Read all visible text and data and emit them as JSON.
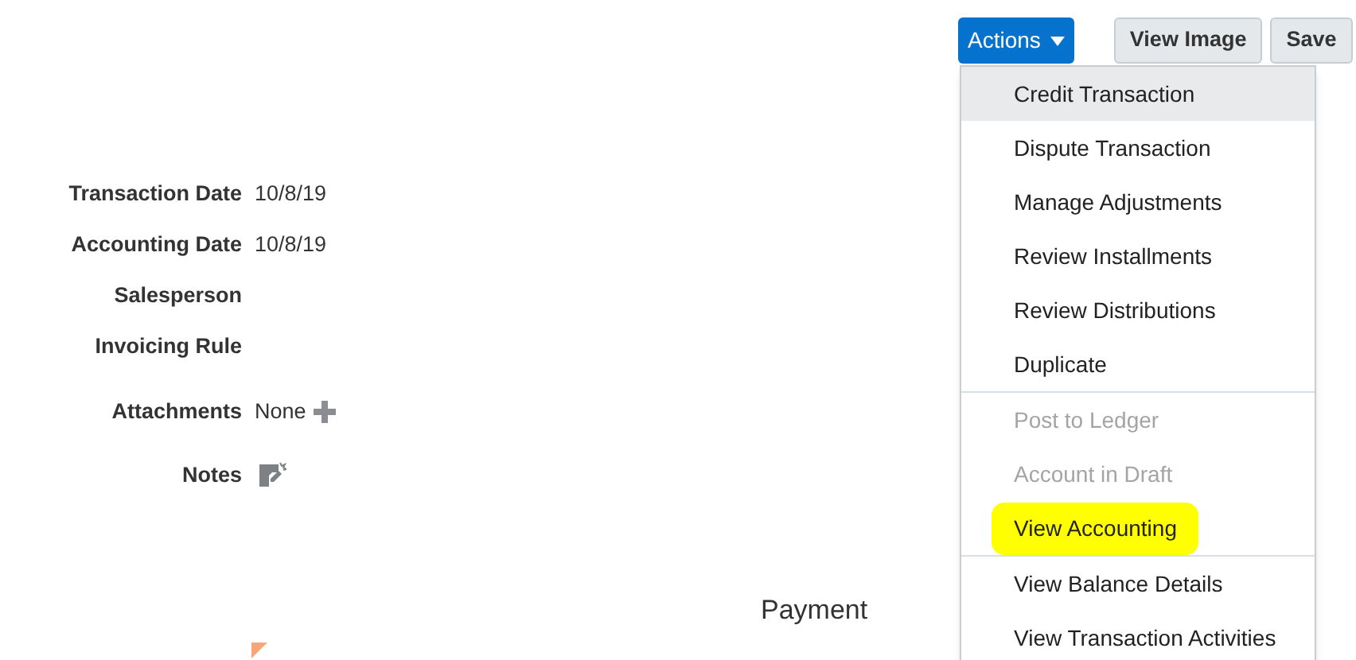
{
  "toolbar": {
    "actions_button": "Actions",
    "buttons": [
      "View Image",
      "Save"
    ]
  },
  "actions_menu": {
    "groups": [
      {
        "items": [
          {
            "label": "Credit Transaction",
            "selected": true,
            "disabled": false,
            "marker_highlight": false
          },
          {
            "label": "Dispute Transaction",
            "selected": false,
            "disabled": false,
            "marker_highlight": false
          },
          {
            "label": "Manage Adjustments",
            "selected": false,
            "disabled": false,
            "marker_highlight": false
          },
          {
            "label": "Review Installments",
            "selected": false,
            "disabled": false,
            "marker_highlight": false
          },
          {
            "label": "Review Distributions",
            "selected": false,
            "disabled": false,
            "marker_highlight": false
          },
          {
            "label": "Duplicate",
            "selected": false,
            "disabled": false,
            "marker_highlight": false
          }
        ]
      },
      {
        "items": [
          {
            "label": "Post to Ledger",
            "selected": false,
            "disabled": true,
            "marker_highlight": false
          },
          {
            "label": "Account in Draft",
            "selected": false,
            "disabled": true,
            "marker_highlight": false
          },
          {
            "label": "View Accounting",
            "selected": false,
            "disabled": false,
            "marker_highlight": true
          }
        ]
      },
      {
        "items": [
          {
            "label": "View Balance Details",
            "selected": false,
            "disabled": false,
            "marker_highlight": false
          },
          {
            "label": "View Transaction Activities",
            "selected": false,
            "disabled": false,
            "marker_highlight": false
          }
        ]
      }
    ]
  },
  "fields": [
    {
      "kind": "text",
      "label": "Transaction Date",
      "value": "10/8/19"
    },
    {
      "kind": "text",
      "label": "Accounting Date",
      "value": "10/8/19"
    },
    {
      "kind": "text",
      "label": "Salesperson"
    },
    {
      "kind": "text",
      "label": "Invoicing Rule"
    },
    {
      "kind": "attachments",
      "label": "Attachments",
      "value": "None"
    },
    {
      "kind": "notes",
      "label": "Notes"
    }
  ],
  "section_title": "Payment"
}
